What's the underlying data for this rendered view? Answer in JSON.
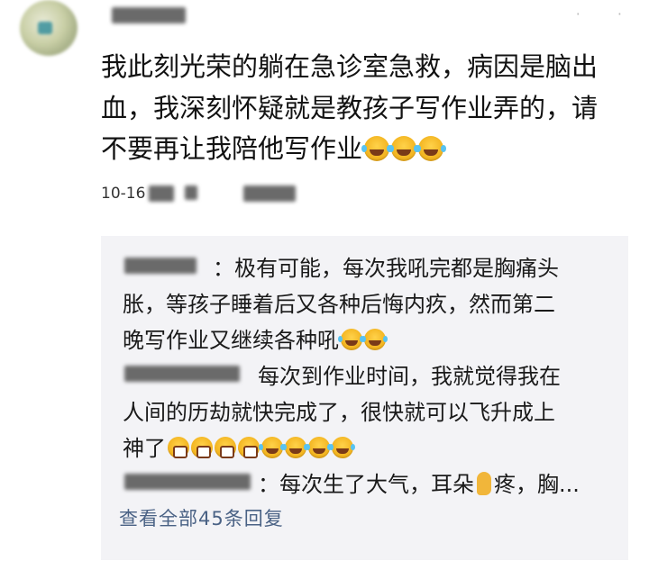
{
  "comment": {
    "lines": [
      "我此刻光荣的躺在急诊室急救，病因是脑出",
      "血，我深刻怀疑就是教孩子写作业弄的，请",
      "不要再让我陪他写作业"
    ],
    "line3_emoji_count": 3,
    "meta_date": "10-16"
  },
  "replies": [
    {
      "lines": [
        "：极有可能，每次我吼完都是胸痛头",
        "胀，等孩子睡着后又各种后悔内疚，然而第二",
        "晚写作业又继续各种吼"
      ],
      "last_line_emoji_count": 2
    },
    {
      "lines": [
        "每次到作业时间，我就觉得我在",
        "人间的历劫就快完成了，很快就可以飞升成上",
        "神了"
      ],
      "grin_count": 4,
      "laugh_count": 4
    },
    {
      "text_before_icon": "：每次生了大气，耳朵",
      "icon": "ear-emoji",
      "text_after_icon": "疼，胸..."
    }
  ],
  "view_all_label": "查看全部45条回复",
  "icons": [
    "avatar",
    "laughing-tears-emoji",
    "grinning-teeth-emoji",
    "ear-emoji"
  ],
  "colors": {
    "reply_bg": "#f3f3f6",
    "link": "#4a6285",
    "emoji": "#f3b521"
  }
}
